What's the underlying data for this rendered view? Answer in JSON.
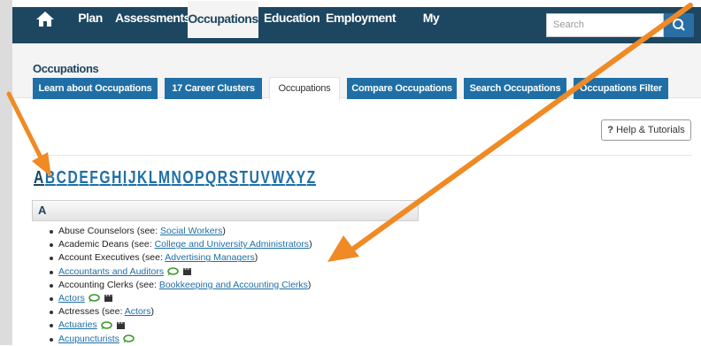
{
  "nav": {
    "items": [
      "Plan",
      "Assessments",
      "Occupations",
      "Education",
      "Employment",
      "My Portfolio"
    ],
    "active": "Occupations",
    "search_placeholder": "Search"
  },
  "section": {
    "title": "Occupations",
    "tabs": [
      "Learn about Occupations",
      "17 Career Clusters",
      "Occupations",
      "Compare Occupations",
      "Search Occupations",
      "Occupations Filter"
    ],
    "active_tab": "Occupations"
  },
  "help": {
    "icon_text": "?",
    "label": "Help & Tutorials"
  },
  "alphabet": [
    "A",
    "B",
    "C",
    "D",
    "E",
    "F",
    "G",
    "H",
    "I",
    "J",
    "K",
    "L",
    "M",
    "N",
    "O",
    "P",
    "Q",
    "R",
    "S",
    "T",
    "U",
    "V",
    "W",
    "X",
    "Y",
    "Z"
  ],
  "current_letter": "A",
  "group": {
    "letter": "A",
    "entries": [
      {
        "prefix": "Abuse Counselors (see: ",
        "link": "Social Workers",
        "suffix": ")",
        "chat": false,
        "video": false
      },
      {
        "prefix": "Academic Deans (see: ",
        "link": "College and University Administrators",
        "suffix": ")",
        "chat": false,
        "video": false
      },
      {
        "prefix": "Account Executives (see: ",
        "link": "Advertising Managers",
        "suffix": ")",
        "chat": false,
        "video": false
      },
      {
        "prefix": "",
        "link": "Accountants and Auditors",
        "suffix": "",
        "chat": true,
        "video": true
      },
      {
        "prefix": "Accounting Clerks (see: ",
        "link": "Bookkeeping and Accounting Clerks",
        "suffix": ")",
        "chat": false,
        "video": false
      },
      {
        "prefix": "",
        "link": "Actors",
        "suffix": "",
        "chat": true,
        "video": true
      },
      {
        "prefix": "Actresses (see: ",
        "link": "Actors",
        "suffix": ")",
        "chat": false,
        "video": false
      },
      {
        "prefix": "",
        "link": "Actuaries",
        "suffix": "",
        "chat": true,
        "video": true
      },
      {
        "prefix": "",
        "link": "Acupuncturists",
        "suffix": "",
        "chat": true,
        "video": false
      }
    ]
  },
  "colors": {
    "nav_bg": "#1d4661",
    "tab_bg": "#1f6fa6",
    "link": "#1f6fa6",
    "annotation_arrow": "#f08a24",
    "chat_icon": "#3a9a2a"
  }
}
